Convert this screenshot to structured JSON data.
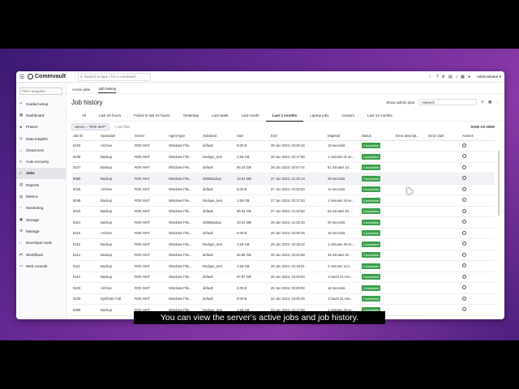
{
  "app": {
    "logo": "Commvault",
    "search_placeholder": "Search or type / for a command",
    "user": "Administrator"
  },
  "sidebar": {
    "filter_placeholder": "Filter navigation",
    "items": [
      {
        "label": "Guided setup",
        "icon": "✔"
      },
      {
        "label": "Dashboard",
        "icon": "▦"
      },
      {
        "label": "Protect",
        "icon": "◈"
      },
      {
        "label": "Data Insights",
        "icon": "◎"
      },
      {
        "label": "Cleanroom",
        "icon": "⌂"
      },
      {
        "label": "Auto recovery",
        "icon": "↻"
      },
      {
        "label": "Jobs",
        "icon": "≡"
      },
      {
        "label": "Reports",
        "icon": "▤"
      },
      {
        "label": "Metrics",
        "icon": "▥"
      },
      {
        "label": "Monitoring",
        "icon": "◔"
      },
      {
        "label": "Storage",
        "icon": "▣"
      },
      {
        "label": "Manage",
        "icon": "⚙"
      },
      {
        "label": "Developer tools",
        "icon": "‹›"
      },
      {
        "label": "Workflows",
        "icon": "⇄"
      },
      {
        "label": "Web console",
        "icon": "▭"
      }
    ],
    "active_index": 6
  },
  "main": {
    "tabs": [
      "Active jobs",
      "Job history"
    ],
    "active_tab": 1,
    "title": "Job history",
    "show_admin_jobs": "Show admin jobs",
    "search_placeholder": "Search",
    "range_tabs": [
      "All",
      "Last 24 hours",
      "Failed in last 24 hours",
      "Yesterday",
      "Last week",
      "Last month",
      "Last 3 months",
      "Laptop jobs",
      "Custom",
      "Last 12 months"
    ],
    "active_range": 6,
    "filter_chip": "Server = \"ROK MAT\"",
    "add_filter": "+ Add filter",
    "save_view": "SAVE AS VIEW",
    "columns": [
      "Job ID",
      "Operation",
      "Server",
      "Agent type",
      "Subclient",
      "Size",
      "End",
      "Elapsed",
      "Status",
      "Error descript...",
      "Error code",
      "Actions"
    ],
    "rows": [
      [
        "5103",
        "Archive",
        "ROK MAT",
        "Windows File...",
        "default",
        "0.00 B",
        "28 Jun 2024, 02:00:16",
        "19 seconds",
        "Completed"
      ],
      [
        "5106",
        "Backup",
        "ROK MAT",
        "Windows File...",
        "Dedupe_test",
        "1.56 GB",
        "28 Jun 2024, 02:17:58",
        "1 minutes 31 se...",
        "Completed"
      ],
      [
        "5107",
        "Backup",
        "ROK MAT",
        "Windows File...",
        "default",
        "55.43 GB",
        "28 Jun 2024, 02:57:44",
        "51 minutes 14 ...",
        "Completed"
      ],
      [
        "5080",
        "Backup",
        "ROK MAT",
        "Windows File...",
        "DDBBackup",
        "10.01 MB",
        "27 Jun 2024, 21:02:13",
        "29 seconds",
        "Completed"
      ],
      [
        "5045",
        "Archive",
        "ROK MAT",
        "Windows File...",
        "default",
        "0.00 B",
        "27 Jun 2024, 02:00:20",
        "14 seconds",
        "Completed"
      ],
      [
        "5048",
        "Backup",
        "ROK MAT",
        "Windows File...",
        "Dedupe_test",
        "1.56 GB",
        "27 Jun 2024, 02:17:53",
        "1 minutes 34 se...",
        "Completed"
      ],
      [
        "5042",
        "Backup",
        "ROK MAT",
        "Windows File...",
        "default",
        "56.02 GB",
        "27 Jun 2024, 01:42:52",
        "54 minutes 54 ...",
        "Completed"
      ],
      [
        "5021",
        "Backup",
        "ROK MAT",
        "Windows File...",
        "DDBBackup",
        "10.01 MB",
        "26 Jun 2024, 21:02:10",
        "20 seconds",
        "Completed"
      ],
      [
        "5116",
        "Archive",
        "ROK MAT",
        "Windows File...",
        "default",
        "0.00 B",
        "26 Jun 2024, 02:00:25",
        "16 seconds",
        "Completed"
      ],
      [
        "5115",
        "Backup",
        "ROK MAT",
        "Windows File...",
        "Dedupe_test",
        "1.56 GB",
        "26 Jun 2024, 02:18:12",
        "1 minutes 46 se...",
        "Completed"
      ],
      [
        "5114",
        "Backup",
        "ROK MAT",
        "Windows File...",
        "default",
        "55.85 GB",
        "26 Jun 2024, 02:42:56",
        "42 minutes 52 ...",
        "Completed"
      ],
      [
        "5111",
        "Backup",
        "ROK MAT",
        "Windows File...",
        "Dedupe_test",
        "1.56 GB",
        "25 Jun 2024, 02:18:01",
        "2 minutes 12 s...",
        "Completed"
      ],
      [
        "5110",
        "Backup",
        "ROK MAT",
        "Windows File...",
        "default",
        "57.97 GB",
        "25 Jun 2024, 03:03:53",
        "1 hours 21 min...",
        "Completed"
      ],
      [
        "5103",
        "Archive",
        "ROK MAT",
        "Windows File...",
        "default",
        "0.00 B",
        "25 Jun 2024, 02:00:08",
        "16 seconds",
        "Completed"
      ],
      [
        "5100",
        "Synthetic Full",
        "ROK MAT",
        "Windows File...",
        "default",
        "0.00 B",
        "24 Jun 2024, 03:00:45",
        "1 hours 31 min...",
        "Completed"
      ],
      [
        "5099",
        "Backup",
        "ROK MAT",
        "Windows File...",
        "Dedupe_test",
        "1.56 GB",
        "24 Jun 2024, 02:17:55",
        "1 minutes 29 se...",
        "Completed"
      ]
    ],
    "highlight_row": 3
  },
  "caption": "You can view the server's active jobs and job history.",
  "colors": {
    "status_completed": "#3a9e4c",
    "background_purple": "#6a2a96"
  }
}
